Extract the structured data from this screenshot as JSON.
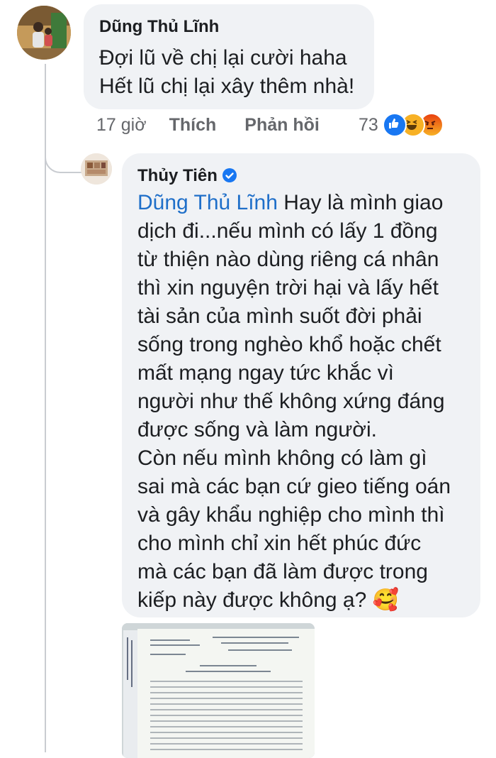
{
  "comment1": {
    "author": "Dũng Thủ Lĩnh",
    "lines": "Đợi lũ về chị lại cười haha\nHết lũ chị lại xây thêm nhà!",
    "time": "17 giờ",
    "like_label": "Thích",
    "reply_label": "Phản hồi",
    "reaction_count": "73",
    "reactions": [
      "like-icon",
      "haha-icon",
      "angry-icon"
    ]
  },
  "reply": {
    "author": "Thủy Tiên",
    "verified_icon": "verified-badge-icon",
    "mention": "Dũng Thủ Lĩnh",
    "text": " Hay là mình giao\ndịch đi...nếu mình có lấy 1 đồng\ntừ thiện nào dùng riêng cá nhân\nthì xin nguyện trời hại và lấy hết\ntài sản của mình suốt đời phải\nsống trong nghèo khổ hoặc  chết\nmất mạng ngay tức khắc vì\nngười như thế không xứng đáng\nđược sống và làm người.\nCòn nếu mình không có làm gì\nsai mà các bạn cứ gieo tiếng oán\nvà gây khẩu nghiệp cho mình thì\ncho mình chỉ xin hết phúc đức\nmà các bạn đã làm được trong\nkiếp này được không ạ? ",
    "emoji": "🥰",
    "attachment_icon": "document-photo-icon"
  },
  "colors": {
    "bubble": "#f0f2f5",
    "mention": "#1f6fc9",
    "verified": "#1877f2",
    "like": "#1877f2",
    "haha": "#f7b125",
    "angry": "#e9710f"
  }
}
